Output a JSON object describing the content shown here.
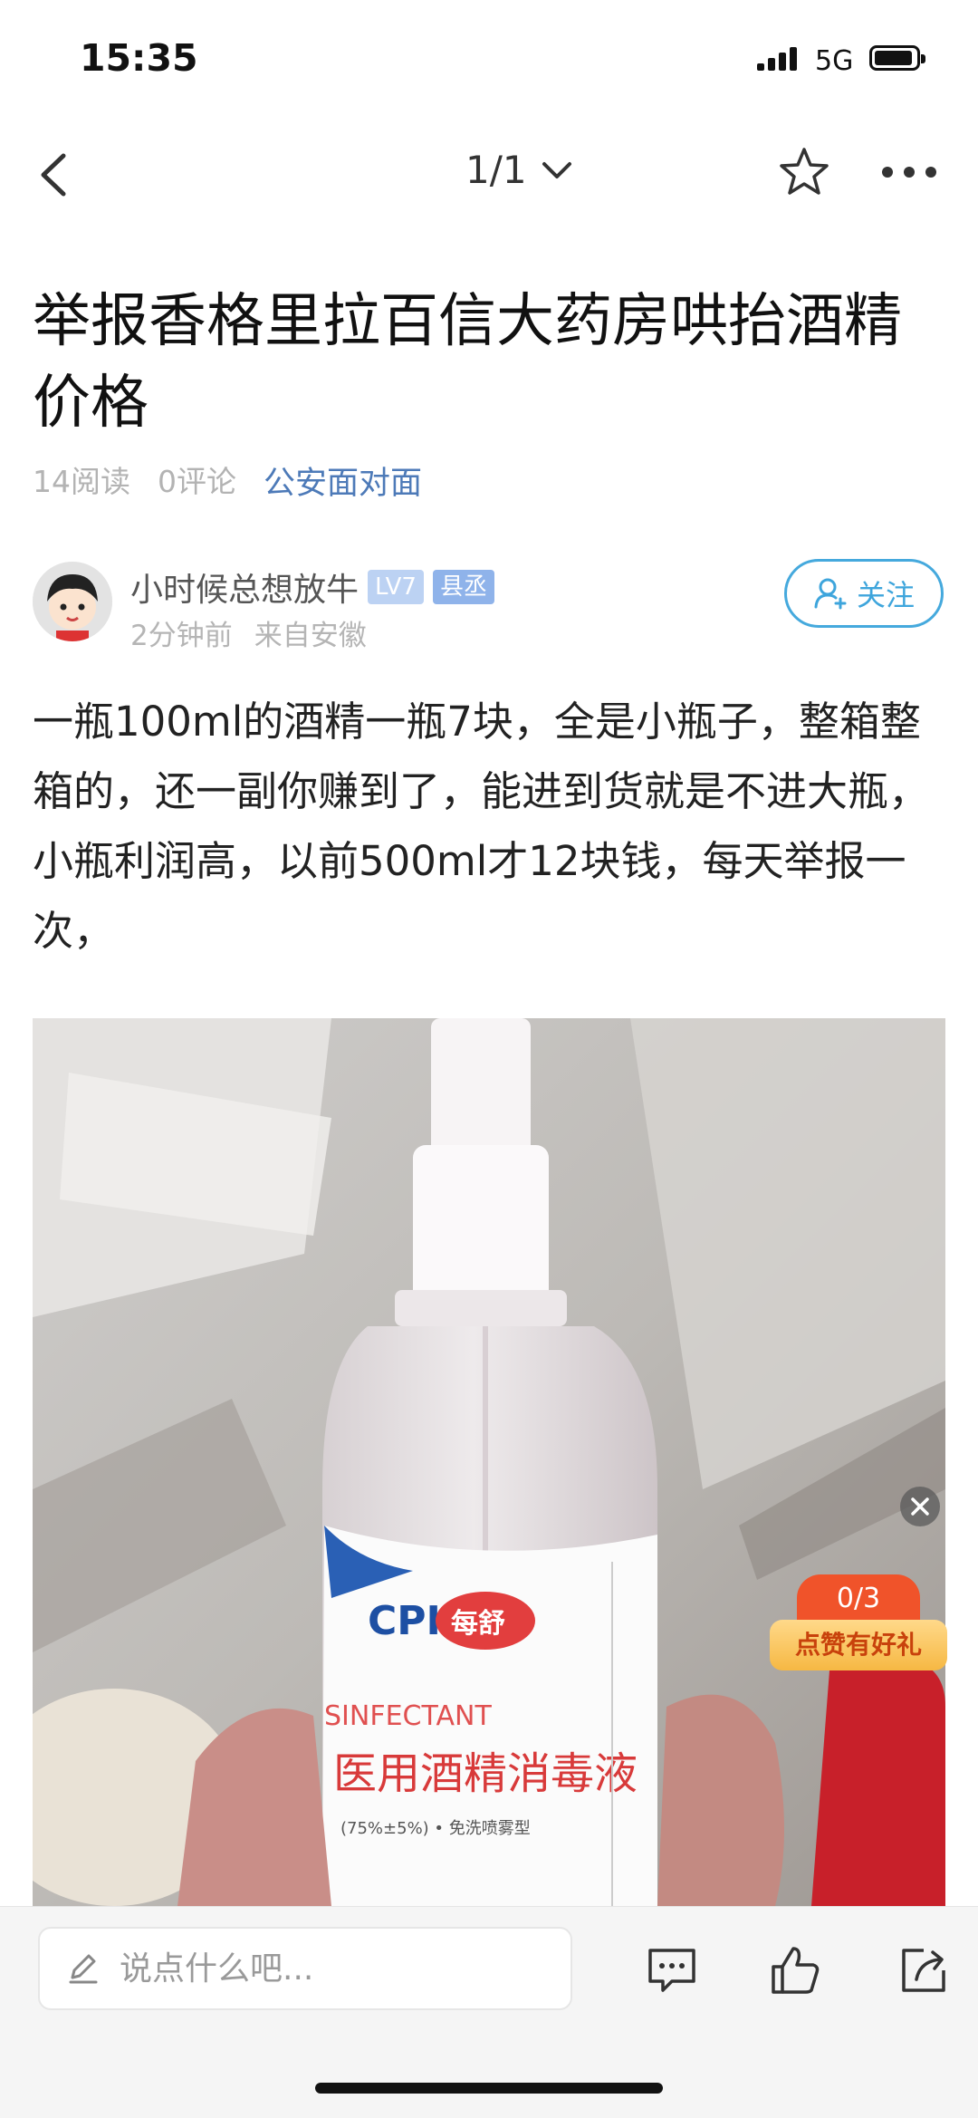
{
  "status_bar": {
    "time": "15:35",
    "network": "5G",
    "battery_icon": "battery-icon"
  },
  "nav": {
    "pager": "1/1"
  },
  "post": {
    "title": "举报香格里拉百信大药房哄抬酒精价格",
    "reads": "14阅读",
    "comments": "0评论",
    "tag": "公安面对面",
    "body": "一瓶100ml的酒精一瓶7块，全是小瓶子，整箱整箱的，还一副你赚到了，能进到货就是不进大瓶，小瓶利润高，以前500ml才12块钱，每天举报一次，"
  },
  "author": {
    "name": "小时候总想放牛",
    "level": "LV7",
    "rank": "县丞",
    "time": "2分钟前",
    "location": "来自安徽",
    "follow_label": "关注"
  },
  "promo": {
    "count": "0/3",
    "label": "点赞有好礼"
  },
  "bottom_bar": {
    "comment_placeholder": "说点什么吧..."
  },
  "colors": {
    "accent_blue": "#3ea5dc",
    "tag_blue": "#4d7ab8",
    "promo_red": "#f0532a",
    "promo_gold": "#f6b843"
  }
}
